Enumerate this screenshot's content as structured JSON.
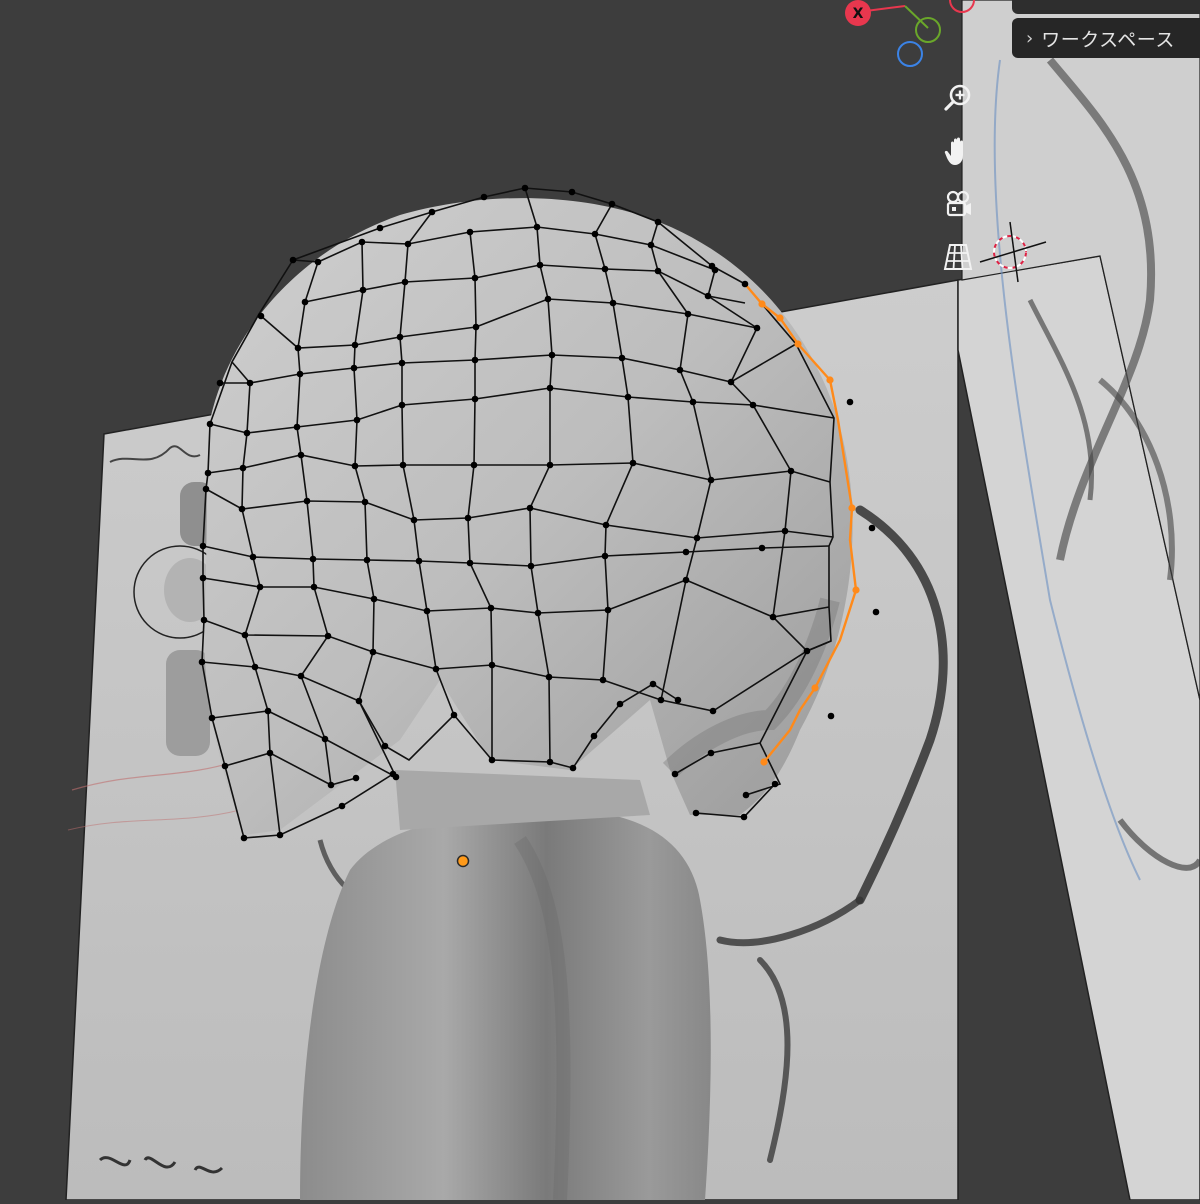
{
  "viewport": {
    "background_color": "#3d3d3d",
    "mesh_wire_color": "#111111",
    "selected_edge_color": "#ff8a1a",
    "gizmo": {
      "x_axis_label": "X",
      "x_color": "#e8374e",
      "y_color": "#6aa72a",
      "z_color": "#3b83e6"
    },
    "nav_buttons": [
      {
        "name": "zoom",
        "icon": "magnifier-plus-icon"
      },
      {
        "name": "pan",
        "icon": "hand-icon"
      },
      {
        "name": "camera-view",
        "icon": "camera-icon"
      },
      {
        "name": "projection-toggle",
        "icon": "grid-perspective-icon"
      }
    ]
  },
  "workspace_panel": {
    "label": "ワークスペース",
    "chevron": "chevron-right-icon"
  }
}
